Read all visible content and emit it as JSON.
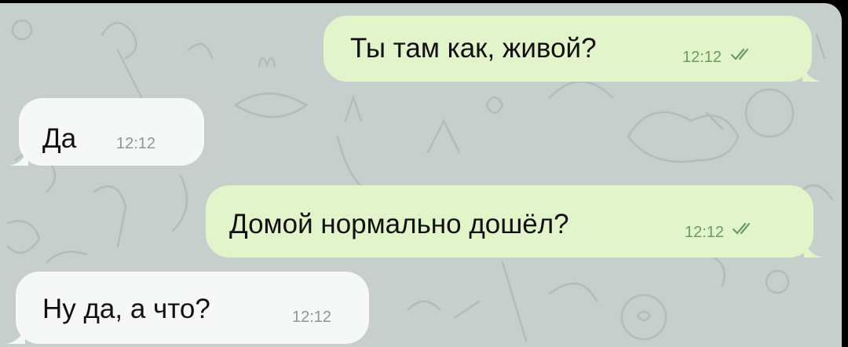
{
  "colors": {
    "chat_background": "#c6cfcc",
    "outgoing_bubble": "#e2f5ca",
    "incoming_bubble": "#f6f8f7",
    "outgoing_time": "#6d9a5d",
    "incoming_time": "#8f9795",
    "text": "#111111"
  },
  "messages": [
    {
      "direction": "outgoing",
      "text": "Ты там как, живой?",
      "time": "12:12",
      "status_icon": "double-check-icon"
    },
    {
      "direction": "incoming",
      "text": "Да",
      "time": "12:12"
    },
    {
      "direction": "outgoing",
      "text": "Домой нормально дошёл?",
      "time": "12:12",
      "status_icon": "double-check-icon"
    },
    {
      "direction": "incoming",
      "text": "Ну да, а что?",
      "time": "12:12"
    }
  ]
}
